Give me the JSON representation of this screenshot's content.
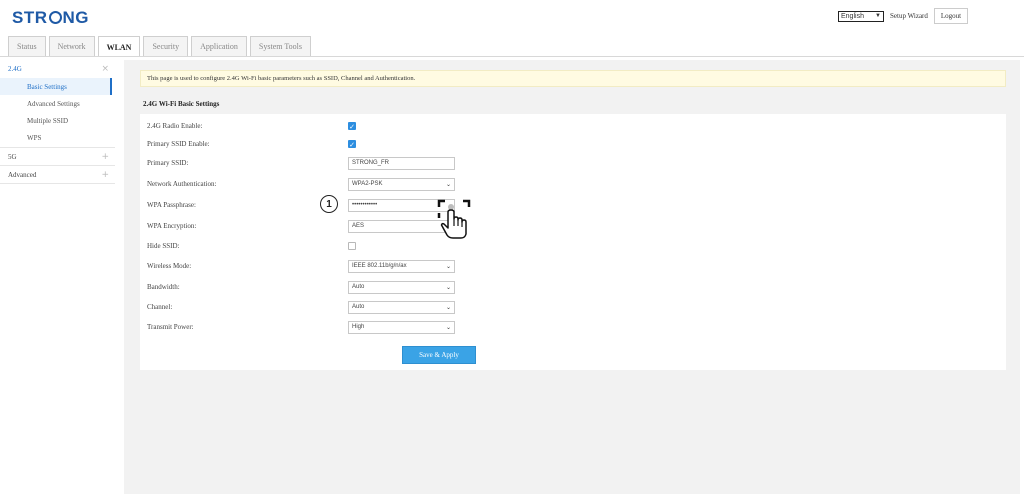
{
  "header": {
    "logo_pre": "STR",
    "logo_post": "NG",
    "language": "English",
    "setup_wizard": "Setup Wizard",
    "logout": "Logout"
  },
  "tabs": [
    {
      "label": "Status",
      "active": false
    },
    {
      "label": "Network",
      "active": false
    },
    {
      "label": "WLAN",
      "active": true
    },
    {
      "label": "Security",
      "active": false
    },
    {
      "label": "Application",
      "active": false
    },
    {
      "label": "System Tools",
      "active": false
    }
  ],
  "sidebar": {
    "section_24": "2.4G",
    "section_24_symbol": "×",
    "items_24": [
      "Basic Settings",
      "Advanced Settings",
      "Multiple SSID",
      "WPS"
    ],
    "section_5": "5G",
    "section_5_symbol": "+",
    "section_adv": "Advanced",
    "section_adv_symbol": "+"
  },
  "main": {
    "notice": "This page is used to configure 2.4G Wi-Fi basic parameters such as SSID, Channel and Authentication.",
    "section_title": "2.4G Wi-Fi Basic Settings",
    "fields": {
      "radio_enable": {
        "label": "2.4G Radio Enable:",
        "checked": true
      },
      "primary_ssid_enable": {
        "label": "Primary SSID Enable:",
        "checked": true
      },
      "primary_ssid": {
        "label": "Primary SSID:",
        "value": "STRONG_FR"
      },
      "auth": {
        "label": "Network Authentication:",
        "value": "WPA2-PSK"
      },
      "passphrase": {
        "label": "WPA Passphrase:",
        "value": "••••••••••••"
      },
      "encryption": {
        "label": "WPA Encryption:",
        "value": "AES"
      },
      "hide_ssid": {
        "label": "Hide SSID:",
        "checked": false
      },
      "wireless_mode": {
        "label": "Wireless Mode:",
        "value": "IEEE 802.11b/g/n/ax"
      },
      "bandwidth": {
        "label": "Bandwidth:",
        "value": "Auto"
      },
      "channel": {
        "label": "Channel:",
        "value": "Auto"
      },
      "tx_power": {
        "label": "Transmit Power:",
        "value": "High"
      }
    },
    "save_label": "Save & Apply"
  },
  "annotation": {
    "step": "1"
  },
  "icons": {
    "check": "check-icon",
    "chevron": "chevron-down-icon",
    "hand": "hand-pointer-icon"
  },
  "colors": {
    "brand": "#1f5aa6",
    "accent": "#3aa3e6",
    "notice_bg": "#fffbe2"
  }
}
